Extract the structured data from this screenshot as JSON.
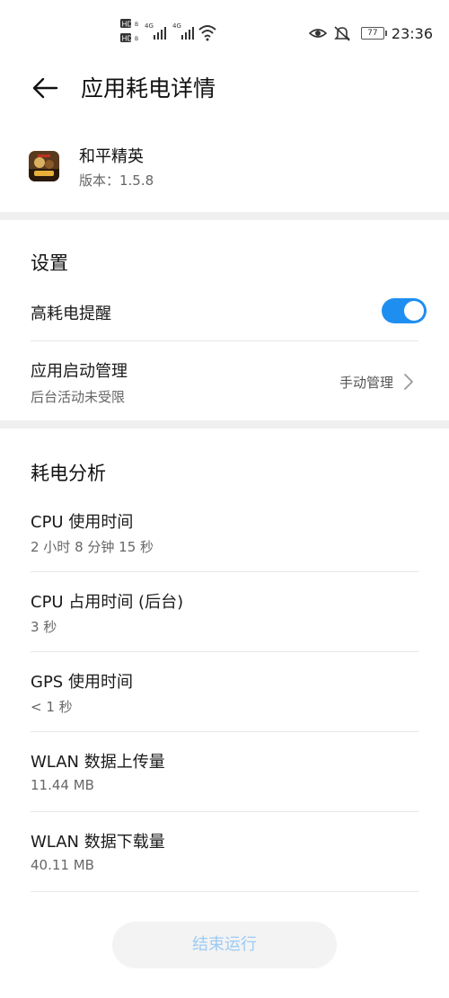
{
  "status_bar": {
    "time": "23:36",
    "battery": "77",
    "hd_1": "HD",
    "hd_2": "HD",
    "net_1": "4G",
    "net_2": "4G"
  },
  "header": {
    "title": "应用耗电详情"
  },
  "app": {
    "name": "和平精英",
    "version": "版本：1.5.8"
  },
  "settings": {
    "section_title": "设置",
    "high_drain_alert": {
      "label": "高耗电提醒",
      "enabled": true
    },
    "launch_manage": {
      "title": "应用启动管理",
      "subtitle": "后台活动未受限",
      "value": "手动管理"
    }
  },
  "analysis": {
    "section_title": "耗电分析",
    "items": [
      {
        "title": "CPU 使用时间",
        "value": "2 小时 8 分钟 15 秒"
      },
      {
        "title": "CPU 占用时间 (后台)",
        "value": "3 秒"
      },
      {
        "title": "GPS 使用时间",
        "value": "< 1 秒"
      },
      {
        "title": "WLAN 数据上传量",
        "value": "11.44 MB"
      },
      {
        "title": "WLAN 数据下载量",
        "value": "40.11 MB"
      }
    ]
  },
  "end_button": {
    "label": "结束运行"
  },
  "colors": {
    "accent": "#1e8ff0",
    "disabled_text": "#9ccbf5",
    "band": "#efefef"
  }
}
